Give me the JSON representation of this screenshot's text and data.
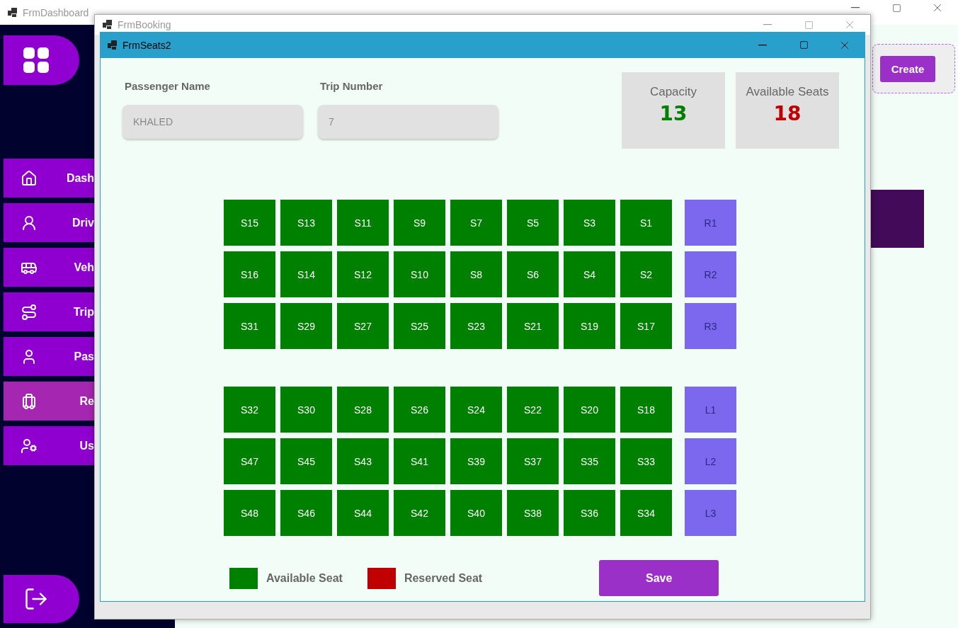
{
  "dashboard": {
    "title": "FrmDashboard",
    "sidebar": {
      "items": [
        {
          "label": "Dash",
          "selected": false
        },
        {
          "label": "Driv",
          "selected": false
        },
        {
          "label": "Veh",
          "selected": false
        },
        {
          "label": "Trip",
          "selected": false
        },
        {
          "label": "Pas",
          "selected": false
        },
        {
          "label": "Re",
          "selected": true
        },
        {
          "label": "Us",
          "selected": false
        }
      ]
    },
    "create_button": "Create"
  },
  "booking": {
    "title": "FrmBooking"
  },
  "seats_window": {
    "title": "FrmSeats2",
    "passenger_name": {
      "label": "Passenger Name",
      "value": "KHALED"
    },
    "trip_number": {
      "label": "Trip Number",
      "value": "7"
    },
    "stats": [
      {
        "label": "Capacity",
        "value": "13",
        "color": "#008000"
      },
      {
        "label": "Available Seats",
        "value": "18",
        "color": "#c00000"
      }
    ],
    "seat_blocks": [
      [
        [
          {
            "label": "S15",
            "color": "#008000"
          },
          {
            "label": "S13",
            "color": "#008000"
          },
          {
            "label": "S11",
            "color": "#008000"
          },
          {
            "label": "S9",
            "color": "#008000"
          },
          {
            "label": "S7",
            "color": "#008000"
          },
          {
            "label": "S5",
            "color": "#008000"
          },
          {
            "label": "S3",
            "color": "#008000"
          },
          {
            "label": "S1",
            "color": "#008000"
          },
          {
            "label": "R1",
            "color": "#7b68ee"
          }
        ],
        [
          {
            "label": "S16",
            "color": "#008000"
          },
          {
            "label": "S14",
            "color": "#008000"
          },
          {
            "label": "S12",
            "color": "#008000"
          },
          {
            "label": "S10",
            "color": "#008000"
          },
          {
            "label": "S8",
            "color": "#008000"
          },
          {
            "label": "S6",
            "color": "#008000"
          },
          {
            "label": "S4",
            "color": "#008000"
          },
          {
            "label": "S2",
            "color": "#008000"
          },
          {
            "label": "R2",
            "color": "#7b68ee"
          }
        ],
        [
          {
            "label": "S31",
            "color": "#008000"
          },
          {
            "label": "S29",
            "color": "#008000"
          },
          {
            "label": "S27",
            "color": "#008000"
          },
          {
            "label": "S25",
            "color": "#008000"
          },
          {
            "label": "S23",
            "color": "#008000"
          },
          {
            "label": "S21",
            "color": "#008000"
          },
          {
            "label": "S19",
            "color": "#008000"
          },
          {
            "label": "S17",
            "color": "#008000"
          },
          {
            "label": "R3",
            "color": "#7b68ee"
          }
        ]
      ],
      [
        [
          {
            "label": "S32",
            "color": "#008000"
          },
          {
            "label": "S30",
            "color": "#008000"
          },
          {
            "label": "S28",
            "color": "#008000"
          },
          {
            "label": "S26",
            "color": "#008000"
          },
          {
            "label": "S24",
            "color": "#008000"
          },
          {
            "label": "S22",
            "color": "#008000"
          },
          {
            "label": "S20",
            "color": "#008000"
          },
          {
            "label": "S18",
            "color": "#008000"
          },
          {
            "label": "L1",
            "color": "#7b68ee"
          }
        ],
        [
          {
            "label": "S47",
            "color": "#008000"
          },
          {
            "label": "S45",
            "color": "#008000"
          },
          {
            "label": "S43",
            "color": "#008000"
          },
          {
            "label": "S41",
            "color": "#008000"
          },
          {
            "label": "S39",
            "color": "#008000"
          },
          {
            "label": "S37",
            "color": "#008000"
          },
          {
            "label": "S35",
            "color": "#008000"
          },
          {
            "label": "S33",
            "color": "#008000"
          },
          {
            "label": "L2",
            "color": "#7b68ee"
          }
        ],
        [
          {
            "label": "S48",
            "color": "#008000"
          },
          {
            "label": "S46",
            "color": "#008000"
          },
          {
            "label": "S44",
            "color": "#008000"
          },
          {
            "label": "S42",
            "color": "#008000"
          },
          {
            "label": "S40",
            "color": "#008000"
          },
          {
            "label": "S38",
            "color": "#008000"
          },
          {
            "label": "S36",
            "color": "#008000"
          },
          {
            "label": "S34",
            "color": "#008000"
          },
          {
            "label": "L3",
            "color": "#7b68ee"
          }
        ]
      ]
    ],
    "legend": [
      {
        "label": "Available Seat",
        "color": "#008000"
      },
      {
        "label": "Reserved Seat",
        "color": "#c00000"
      }
    ],
    "save_button": "Save"
  }
}
